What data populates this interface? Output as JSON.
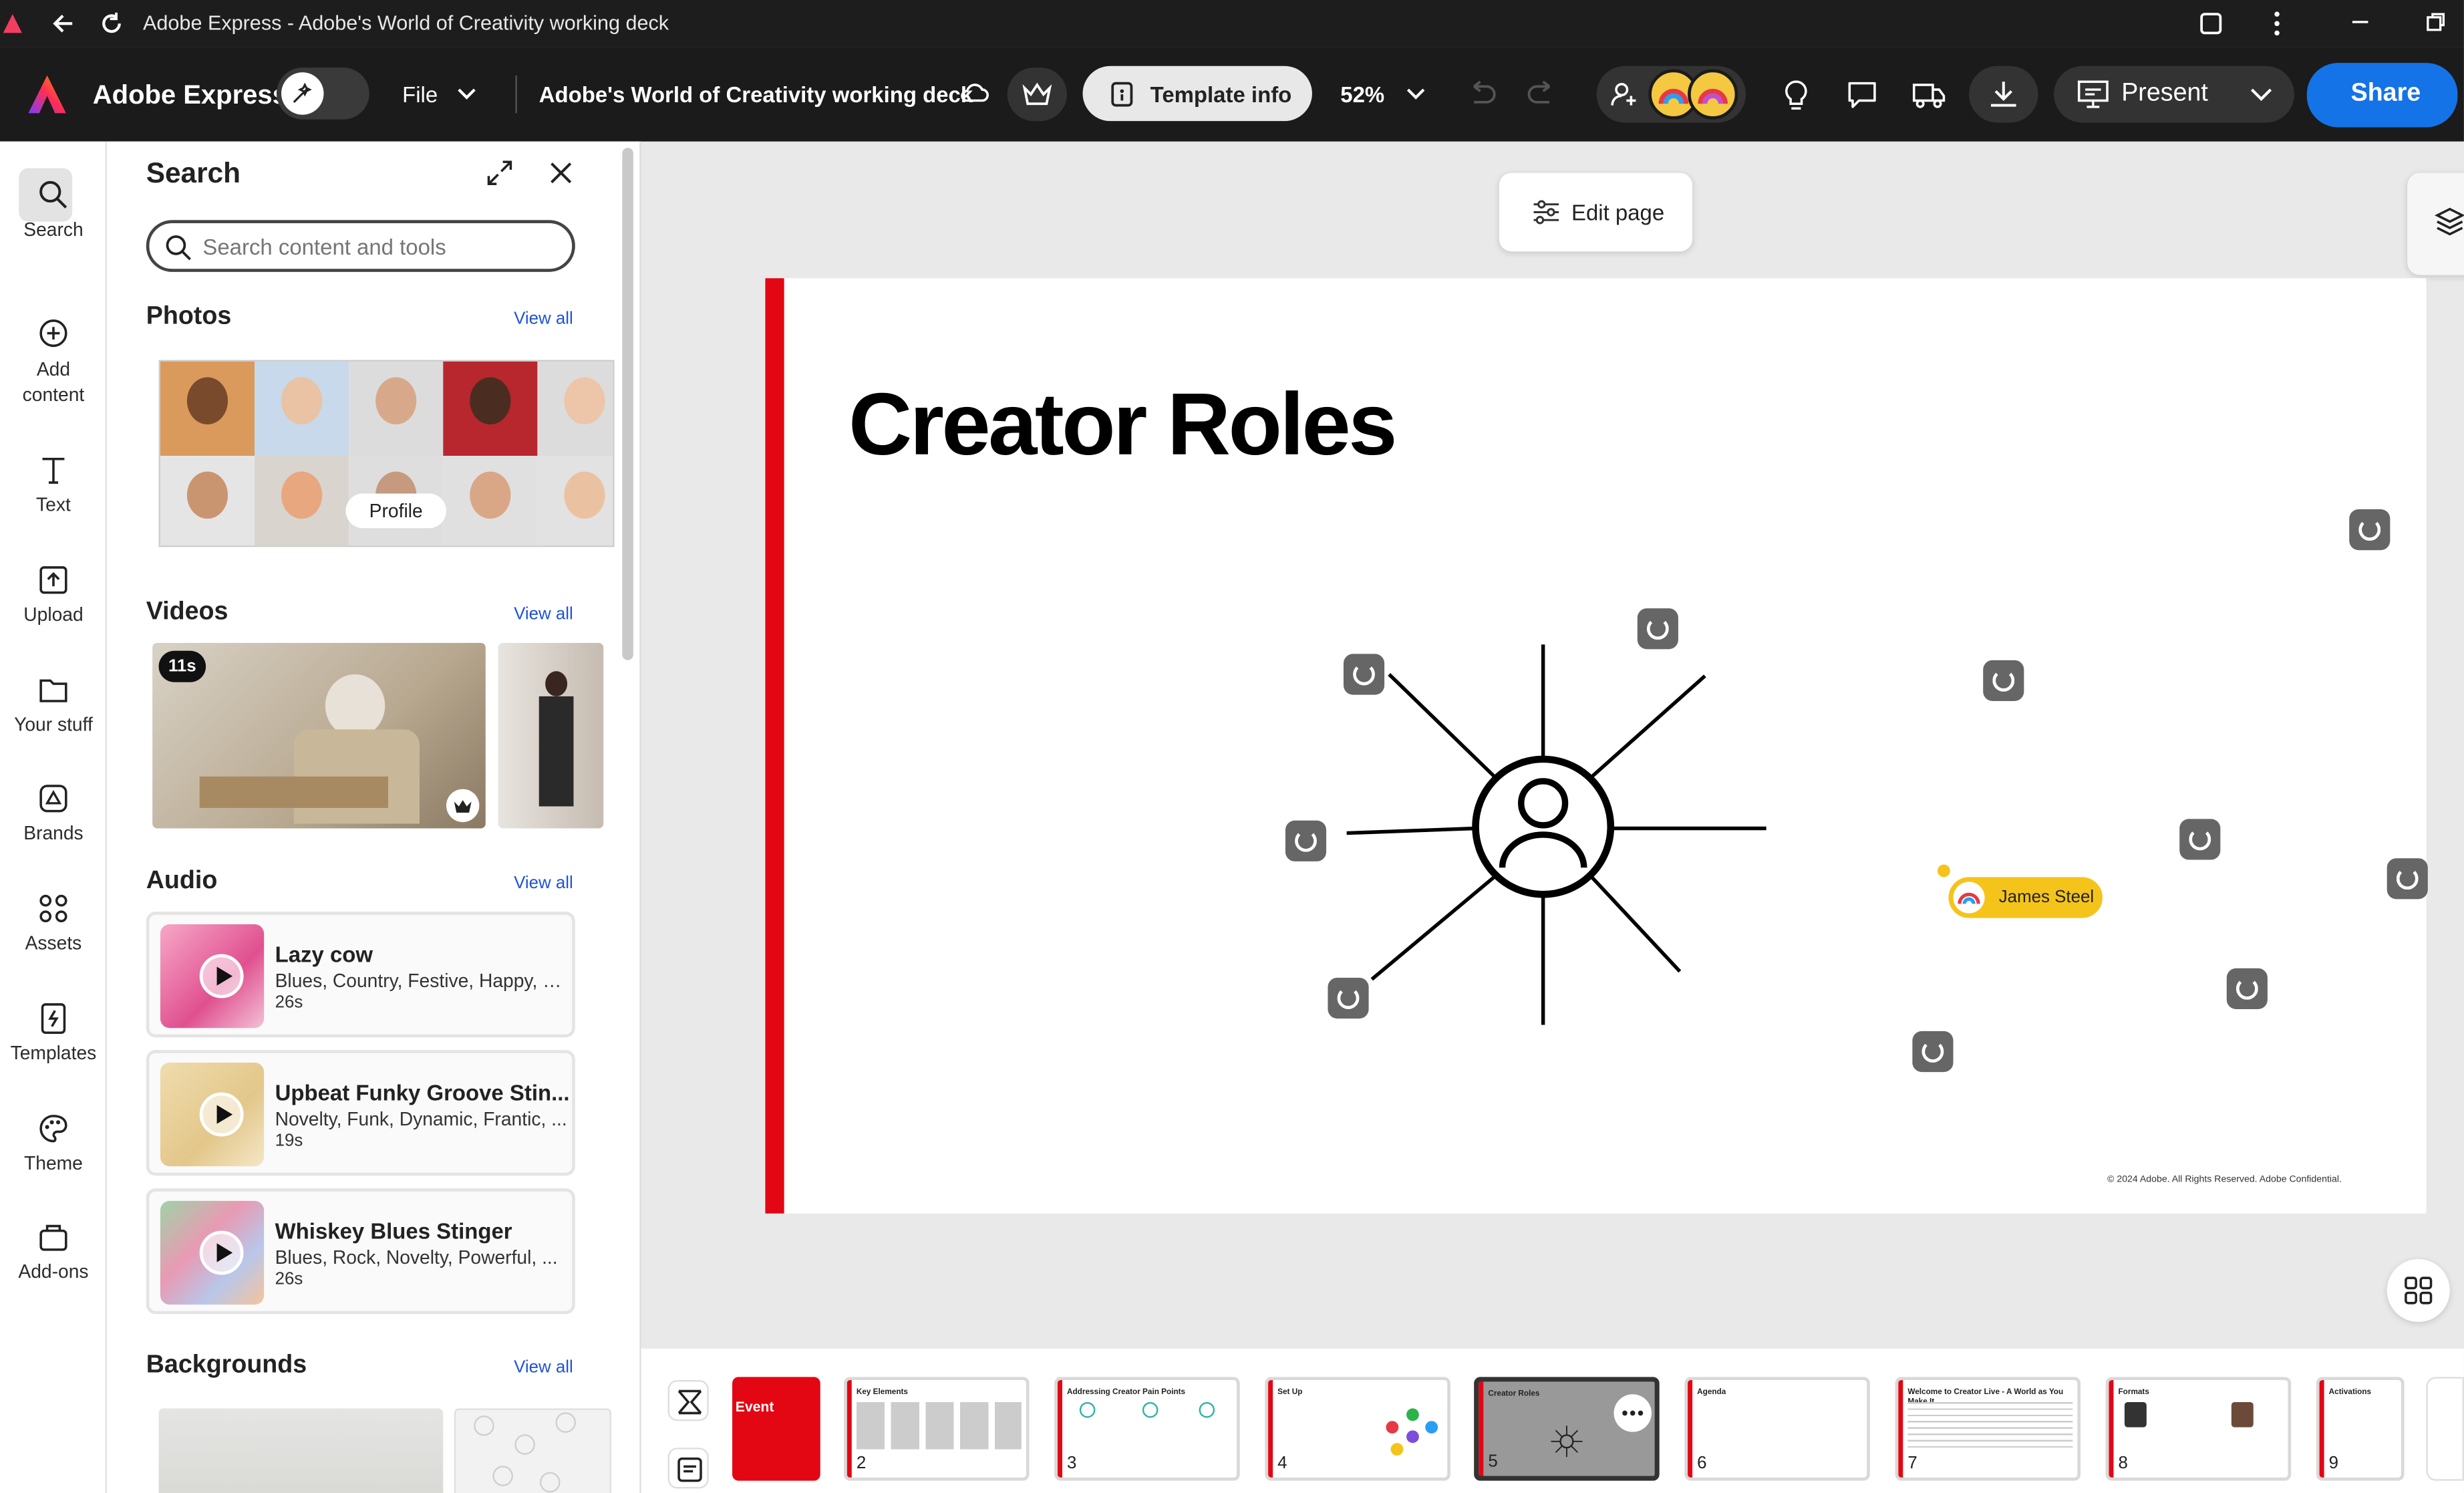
{
  "window": {
    "title": "Adobe Express - Adobe's World of Creativity working deck"
  },
  "topbar": {
    "brand": "Adobe Express",
    "file_label": "File",
    "doc_title": "Adobe's World of Creativity working deck",
    "template_info_label": "Template info",
    "zoom": "52%",
    "present_label": "Present",
    "share_label": "Share"
  },
  "rail": {
    "items": [
      {
        "label": "Search",
        "icon": "search-icon"
      },
      {
        "label": "Add content",
        "icon": "plus-circle-icon"
      },
      {
        "label": "Text",
        "icon": "text-icon"
      },
      {
        "label": "Upload",
        "icon": "upload-icon"
      },
      {
        "label": "Your stuff",
        "icon": "folder-icon"
      },
      {
        "label": "Brands",
        "icon": "brand-icon"
      },
      {
        "label": "Assets",
        "icon": "assets-icon"
      },
      {
        "label": "Templates",
        "icon": "templates-icon"
      },
      {
        "label": "Theme",
        "icon": "palette-icon"
      },
      {
        "label": "Add-ons",
        "icon": "addons-icon"
      }
    ]
  },
  "panel": {
    "title": "Search",
    "search_placeholder": "Search content and tools",
    "photos_title": "Photos",
    "photos_view_all": "View all",
    "photo_hover_label": "Profile",
    "videos_title": "Videos",
    "videos_view_all": "View all",
    "video_badge": "11s",
    "audio_title": "Audio",
    "audio_view_all": "View all",
    "audio": [
      {
        "name": "Lazy cow",
        "tags": "Blues, Country, Festive, Happy, Pl...",
        "duration": "26s"
      },
      {
        "name": "Upbeat Funky Groove Stin...",
        "tags": "Novelty, Funk, Dynamic, Frantic, ...",
        "duration": "19s"
      },
      {
        "name": "Whiskey Blues Stinger",
        "tags": "Blues, Rock, Novelty, Powerful, ...",
        "duration": "26s"
      }
    ],
    "backgrounds_title": "Backgrounds",
    "backgrounds_view_all": "View all"
  },
  "canvas": {
    "edit_page_label": "Edit page",
    "slide_title": "Creator Roles",
    "footer": "© 2024 Adobe. All Rights Reserved. Adobe Confidential.",
    "collaborator_name": "James Steel"
  },
  "thumbnails": [
    {
      "num": "",
      "title": "Event"
    },
    {
      "num": "2",
      "title": "Key Elements"
    },
    {
      "num": "3",
      "title": "Addressing Creator Pain Points"
    },
    {
      "num": "4",
      "title": "Set Up"
    },
    {
      "num": "5",
      "title": "Creator Roles"
    },
    {
      "num": "6",
      "title": "Agenda"
    },
    {
      "num": "7",
      "title": "Welcome to Creator Live - A World as You Make It"
    },
    {
      "num": "8",
      "title": "Formats"
    },
    {
      "num": "9",
      "title": "Activations"
    }
  ],
  "colors": {
    "accent": "#1473e6",
    "slide_red": "#e30613",
    "topbar_bg": "#1b1b1b"
  }
}
